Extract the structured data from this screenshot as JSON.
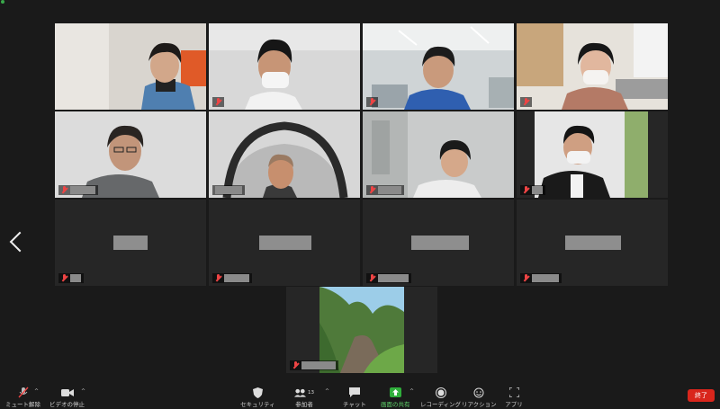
{
  "colors": {
    "active_speaker": "#d6ec4a",
    "end_button": "#d9261c",
    "share_green": "#2fae3b",
    "muted_red": "#e44444"
  },
  "nav": {
    "prev_page_icon": "chevron-left-icon"
  },
  "toolbar": {
    "mute_label": "ミュート解除",
    "video_label": "ビデオの停止",
    "security_label": "セキュリティ",
    "participants_label": "参加者",
    "participants_count": "13",
    "chat_label": "チャット",
    "share_label": "画面の共有",
    "record_label": "レコーディング",
    "reactions_label": "リアクション",
    "apps_label": "アプリ",
    "end_label": "終了"
  }
}
